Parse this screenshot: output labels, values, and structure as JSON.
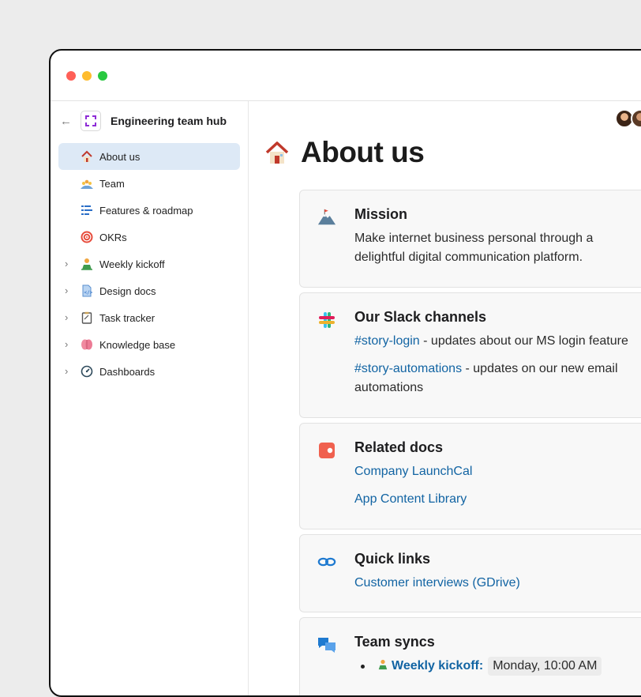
{
  "sidebar": {
    "title": "Engineering team hub",
    "items": [
      {
        "label": "About us"
      },
      {
        "label": "Team"
      },
      {
        "label": "Features & roadmap"
      },
      {
        "label": "OKRs"
      },
      {
        "label": "Weekly kickoff"
      },
      {
        "label": "Design docs"
      },
      {
        "label": "Task tracker"
      },
      {
        "label": "Knowledge base"
      },
      {
        "label": "Dashboards"
      }
    ],
    "chevron": "›",
    "back": "←"
  },
  "page": {
    "title": "About us"
  },
  "cards": {
    "mission": {
      "title": "Mission",
      "text": "Make internet business personal through a delightful digital communication platform."
    },
    "slack": {
      "title": "Our Slack channels",
      "ch1": "#story-login",
      "ch1_desc": " - updates about our MS login feature",
      "ch2": "#story-automations",
      "ch2_desc": " - updates on our new email",
      "ch2_desc2": "automations"
    },
    "docs": {
      "title": "Related docs",
      "link1": "Company LaunchCal",
      "link2": "App Content Library"
    },
    "quick": {
      "title": "Quick links",
      "link1": "Customer interviews (GDrive)"
    },
    "syncs": {
      "title": "Team syncs",
      "item1_link": "Weekly kickoff:",
      "item1_time": "Monday, 10:00 AM"
    }
  },
  "colors": {
    "accent_link": "#1264a3",
    "active_nav": "#dde9f6"
  }
}
